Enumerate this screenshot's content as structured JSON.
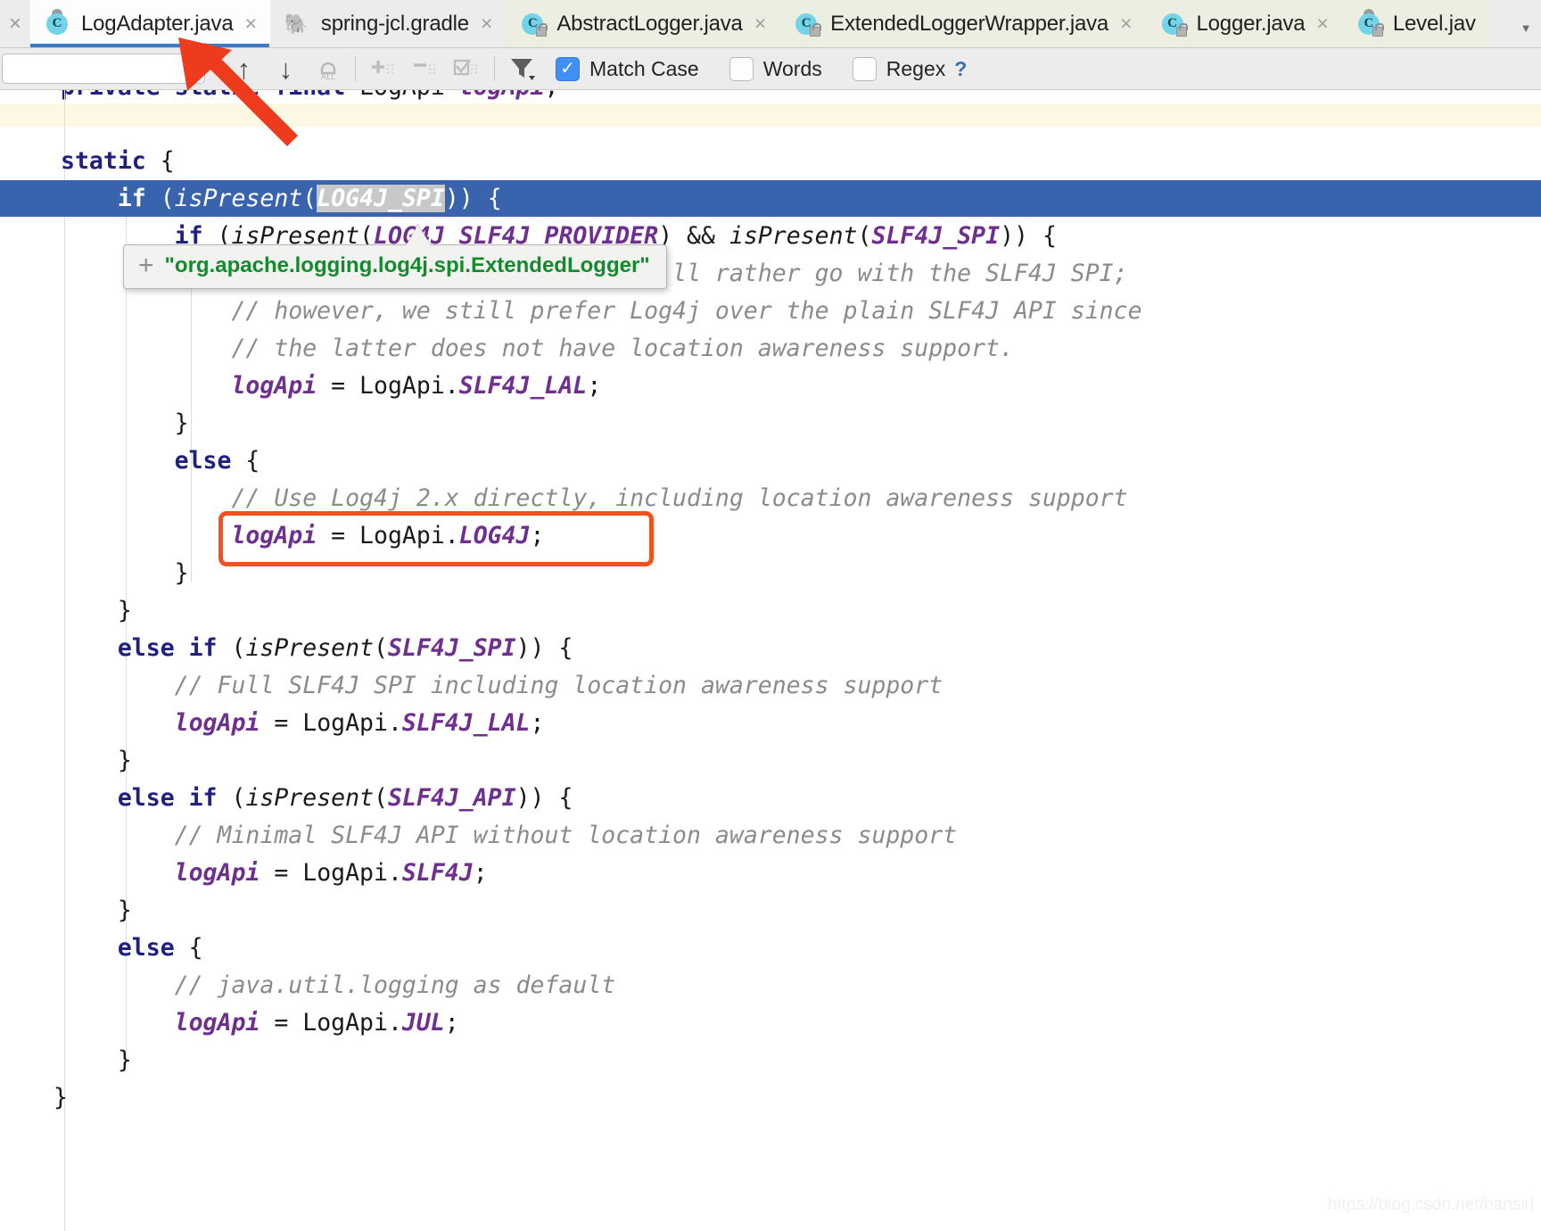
{
  "tabs": [
    {
      "label": "LogAdapter.java",
      "icon": "java-class-icon",
      "active": true,
      "pinned": true,
      "locked": false,
      "close": "×"
    },
    {
      "label": "spring-jcl.gradle",
      "icon": "gradle-elephant-icon",
      "active": false,
      "pinned": false,
      "locked": false,
      "close": "×"
    },
    {
      "label": "AbstractLogger.java",
      "icon": "java-class-locked-icon",
      "active": false,
      "pinned": false,
      "locked": true,
      "close": "×"
    },
    {
      "label": "ExtendedLoggerWrapper.java",
      "icon": "java-class-locked-icon",
      "active": false,
      "pinned": false,
      "locked": true,
      "close": "×"
    },
    {
      "label": "Logger.java",
      "icon": "java-class-locked-icon",
      "active": false,
      "pinned": false,
      "locked": true,
      "close": "×"
    },
    {
      "label": "Level.jav",
      "icon": "java-class-locked-icon",
      "active": false,
      "pinned": true,
      "locked": true,
      "close": ""
    }
  ],
  "tabbar": {
    "leading_close": "×",
    "overflow": "▼",
    "active_underline_color": "#3c79c8",
    "readonly_tab_bg": "#eceee2"
  },
  "search_toolbar": {
    "search_value": "",
    "search_placeholder": "",
    "return_glyph": "↵",
    "prev_match_label": "↑",
    "next_match_label": "↓",
    "select_all_label": "ALL",
    "add_occurrence_label": "+",
    "remove_occurrence_label": "−",
    "select_all_occurrences_label": "☑",
    "filter_label": "filter",
    "checkboxes": [
      {
        "label": "Match Case",
        "checked": true,
        "check_glyph": "✓"
      },
      {
        "label": "Words",
        "checked": false,
        "check_glyph": ""
      },
      {
        "label": "Regex",
        "checked": false,
        "check_glyph": ""
      }
    ],
    "help_label": "?",
    "accent_color": "#3f8ff5"
  },
  "tooltip": {
    "plus": "+",
    "text": "\"org.apache.logging.log4j.spi.ExtendedLogger\"",
    "text_color": "#138a2c"
  },
  "annotations": {
    "red_box_color": "#f4511e",
    "arrow_color": "#ee3b1e",
    "watermark": "https://blog.csdn.net/hansirl"
  },
  "editor": {
    "highlighted_search_term": "LOG4J_SPI",
    "clipped_first_line": "private static final LogApi logApi;",
    "lines": [
      {
        "text": "static {"
      },
      {
        "text": "    if (isPresent(LOG4J_SPI)) {"
      },
      {
        "text": "        if (isPresent(LOG4J_SLF4J_PROVIDER) && isPresent(SLF4J_SPI)) {"
      },
      {
        "text": "            // log4j-to-slf4j bridge -> we'll rather go with the SLF4J SPI;"
      },
      {
        "text": "            // however, we still prefer Log4j over the plain SLF4J API since"
      },
      {
        "text": "            // the latter does not have location awareness support."
      },
      {
        "text": "            logApi = LogApi.SLF4J_LAL;"
      },
      {
        "text": "        }"
      },
      {
        "text": "        else {"
      },
      {
        "text": "            // Use Log4j 2.x directly, including location awareness support"
      },
      {
        "text": "            logApi = LogApi.LOG4J;"
      },
      {
        "text": "        }"
      },
      {
        "text": "    }"
      },
      {
        "text": "    else if (isPresent(SLF4J_SPI)) {"
      },
      {
        "text": "        // Full SLF4J SPI including location awareness support"
      },
      {
        "text": "        logApi = LogApi.SLF4J_LAL;"
      },
      {
        "text": "    }"
      },
      {
        "text": "    else if (isPresent(SLF4J_API)) {"
      },
      {
        "text": "        // Minimal SLF4J API without location awareness support"
      },
      {
        "text": "        logApi = LogApi.SLF4J;"
      },
      {
        "text": "    }"
      },
      {
        "text": "    else {"
      },
      {
        "text": "        // java.util.logging as default"
      },
      {
        "text": "        logApi = LogApi.JUL;"
      },
      {
        "text": "    }"
      },
      {
        "text": "}"
      }
    ]
  },
  "code_tokens": {
    "l0": {
      "a": "static",
      "b": " {"
    },
    "l1": {
      "a": "if",
      "b": " (",
      "c": "isPresent",
      "d": "(",
      "e": "LOG4J_SPI",
      "f": ")) {"
    },
    "l2": {
      "a": "if",
      "b": " (",
      "c": "isPresent",
      "d": "(",
      "e": "LOG4J_SLF4J_PROVIDER",
      "f": ") && ",
      "g": "isPresent",
      "h": "(",
      "i": "SLF4J_SPI",
      "j": ")) {"
    },
    "l3": "// log4j-to-slf4j bridge -> we'll rather go with the SLF4J SPI;",
    "l4": "// however, we still prefer Log4j over the plain SLF4J API since",
    "l5": "// the latter does not have location awareness support.",
    "l6": {
      "a": "logApi",
      "b": " = LogApi.",
      "c": "SLF4J_LAL",
      "d": ";"
    },
    "l7": "}",
    "l8": {
      "a": "else",
      "b": " {"
    },
    "l9": "// Use Log4j 2.x directly, including location awareness support",
    "l10": {
      "a": "logApi",
      "b": " = LogApi.",
      "c": "LOG4J",
      "d": ";"
    },
    "l11": "}",
    "l12": "}",
    "l13": {
      "a": "else if",
      "b": " (",
      "c": "isPresent",
      "d": "(",
      "e": "SLF4J_SPI",
      "f": ")) {"
    },
    "l14": "// Full SLF4J SPI including location awareness support",
    "l15": {
      "a": "logApi",
      "b": " = LogApi.",
      "c": "SLF4J_LAL",
      "d": ";"
    },
    "l16": "}",
    "l17": {
      "a": "else if",
      "b": " (",
      "c": "isPresent",
      "d": "(",
      "e": "SLF4J_API",
      "f": ")) {"
    },
    "l18": "// Minimal SLF4J API without location awareness support",
    "l19": {
      "a": "logApi",
      "b": " = LogApi.",
      "c": "SLF4J",
      "d": ";"
    },
    "l20": "}",
    "l21": {
      "a": "else",
      "b": " {"
    },
    "l22": "// java.util.logging as default",
    "l23": {
      "a": "logApi",
      "b": " = LogApi.",
      "c": "JUL",
      "d": ";"
    },
    "l24": "}",
    "l25": "}"
  }
}
